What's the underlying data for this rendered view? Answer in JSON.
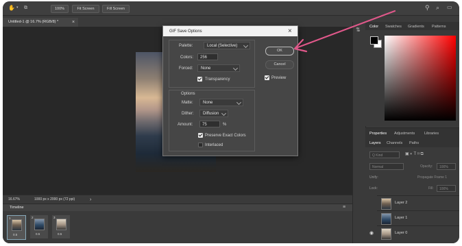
{
  "options_bar": {
    "zoom": "100%",
    "fit_screen": "Fit Screen",
    "fill_screen": "Fill Screen"
  },
  "document": {
    "tab_title": "Untitled-1 @ 16.7% (RGB/8) *",
    "close_glyph": "×"
  },
  "status_bar": {
    "zoom": "16.67%",
    "dimensions": "1000 px x 2000 px (72 ppi)",
    "arrow": "›"
  },
  "timeline": {
    "title": "Timeline",
    "frames": [
      {
        "num": "1",
        "delay": "0.5"
      },
      {
        "num": "2",
        "delay": "0.5"
      },
      {
        "num": "3",
        "delay": "0.5"
      }
    ]
  },
  "dialog": {
    "title": "GIF Save Options",
    "close": "×",
    "palette_label": "Palette:",
    "palette_value": "Local (Selective)",
    "colors_label": "Colors:",
    "colors_value": "256",
    "forced_label": "Forced:",
    "forced_value": "None",
    "transparency_label": "Transparency",
    "options_title": "Options",
    "matte_label": "Matte:",
    "matte_value": "None",
    "dither_label": "Dither:",
    "dither_value": "Diffusion",
    "amount_label": "Amount:",
    "amount_value": "75",
    "amount_unit": "%",
    "preserve_label": "Preserve Exact Colors",
    "interlaced_label": "Interlaced",
    "ok_label": "OK",
    "cancel_label": "Cancel",
    "preview_label": "Preview",
    "transparency_checked": true,
    "preserve_checked": true,
    "interlaced_checked": false,
    "preview_checked": true
  },
  "color_panel": {
    "tabs": [
      "Color",
      "Swatches",
      "Gradients",
      "Patterns"
    ]
  },
  "properties_panel": {
    "tabs": [
      "Properties",
      "Adjustments",
      "Libraries"
    ]
  },
  "layers_panel": {
    "tabs": [
      "Layers",
      "Channels",
      "Paths"
    ],
    "kind_label": "Q Kind",
    "blend_mode": "Normal",
    "opacity_label": "Opacity:",
    "opacity_value": "100%",
    "unify_label": "Unify:",
    "propagate_label": "Propagate Frame 1",
    "lock_label": "Lock:",
    "fill_label": "Fill:",
    "fill_value": "100%",
    "layers": [
      {
        "name": "Layer 2",
        "visible": false
      },
      {
        "name": "Layer 1",
        "visible": false
      },
      {
        "name": "Layer 0",
        "visible": true
      }
    ]
  },
  "colors": {
    "accent_arrow": "#e0588a",
    "app_bg": "#3b3b3b",
    "canvas_bg": "#282828",
    "dialog_bg": "#464646"
  }
}
